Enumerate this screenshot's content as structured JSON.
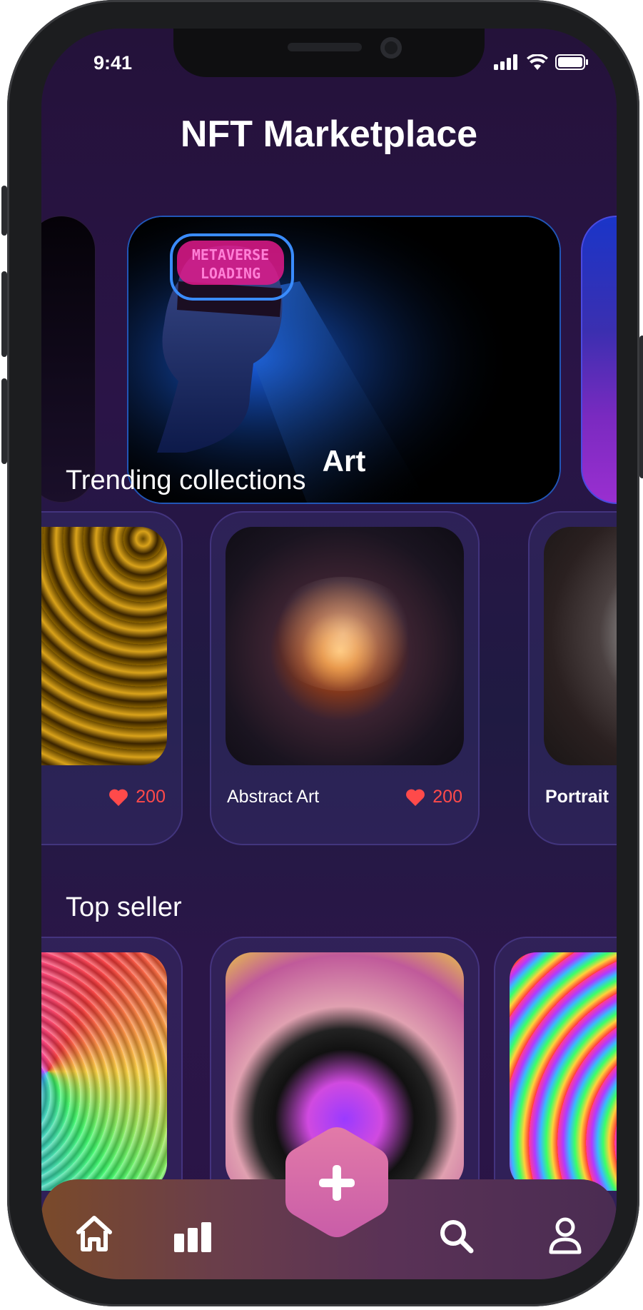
{
  "status_bar": {
    "time": "9:41"
  },
  "header": {
    "title": "NFT Marketplace"
  },
  "hero": {
    "label": "Art",
    "banner_text_line1": "METAVERSE",
    "banner_text_line2": "LOADING"
  },
  "trending": {
    "title": "Trending collections",
    "cards": [
      {
        "label": "",
        "likes": "200"
      },
      {
        "label": "Abstract Art",
        "likes": "200"
      },
      {
        "label": "Portrait",
        "likes": ""
      }
    ]
  },
  "top_seller": {
    "title": "Top seller"
  },
  "nav": {
    "items": [
      {
        "icon": "home-icon"
      },
      {
        "icon": "bar-chart-icon"
      },
      {
        "icon": "add-icon"
      },
      {
        "icon": "search-icon"
      },
      {
        "icon": "profile-icon"
      }
    ]
  },
  "colors": {
    "background": "#24123a",
    "heart": "#ff4a4a",
    "fab": "#d66ba6",
    "hero_border": "#2156b7"
  }
}
